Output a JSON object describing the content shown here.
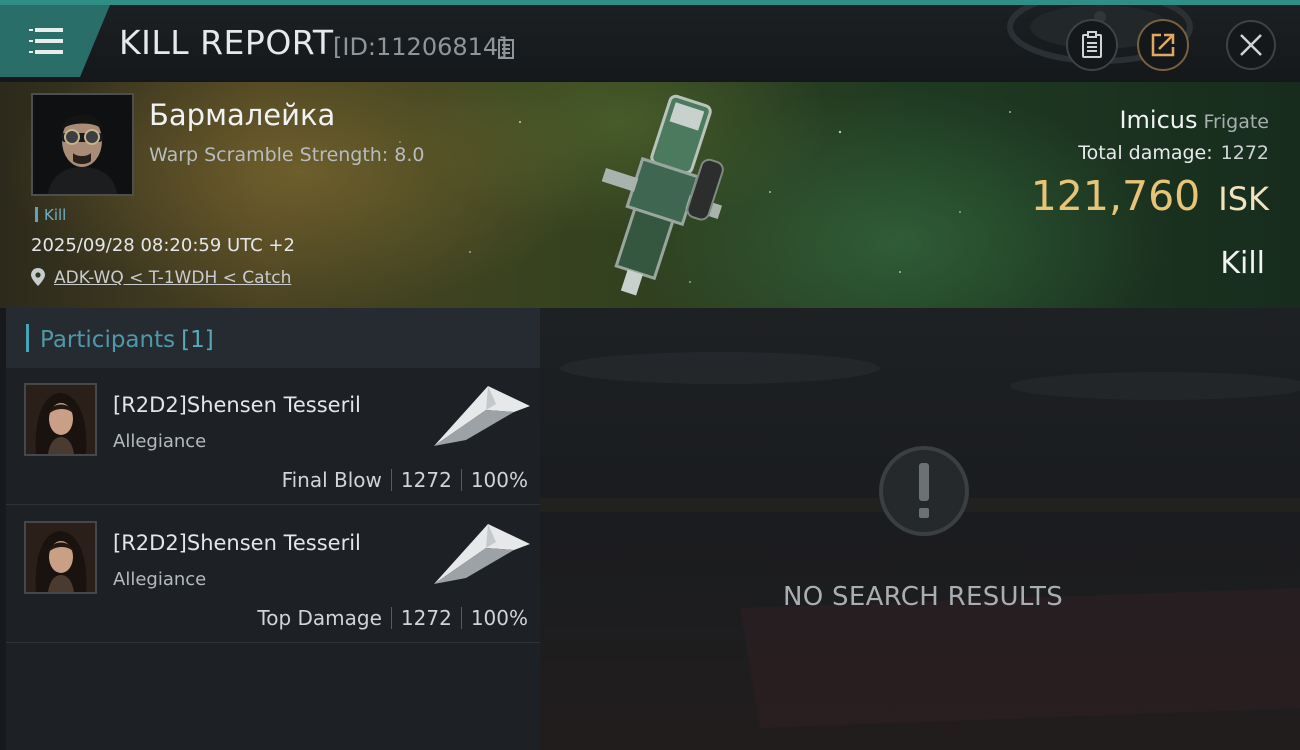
{
  "header": {
    "title": "KILL REPORT",
    "report_id": "[ID:11206814]",
    "icons": {
      "menu": "hamburger-menu-icon",
      "copy": "copy-icon",
      "clipboard": "clipboard-icon",
      "share": "share-icon",
      "close": "close-icon"
    }
  },
  "victim": {
    "name": "Бармалейка",
    "subtitle": "Warp Scramble Strength: 8.0",
    "kill_tag": "Kill",
    "timestamp": "2025/09/28 08:20:59 UTC +2",
    "location": "ADK-WQ < T-1WDH < Catch",
    "ship_name": "Imicus",
    "ship_class": "Frigate",
    "damage_label": "Total damage:",
    "damage_value": "1272",
    "isk_value": "121,760",
    "isk_unit": "ISK",
    "result": "Kill"
  },
  "participants": {
    "label": "Participants",
    "count": "[1]",
    "rows": [
      {
        "name": "[R2D2]Shensen Tesseril",
        "corp": "Allegiance",
        "role": "Final Blow",
        "damage": "1272",
        "percent": "100%"
      },
      {
        "name": "[R2D2]Shensen Tesseril",
        "corp": "Allegiance",
        "role": "Top Damage",
        "damage": "1272",
        "percent": "100%"
      }
    ]
  },
  "empty_state": {
    "text": "NO SEARCH RESULTS",
    "icon": "exclamation-icon"
  },
  "colors": {
    "accent_teal": "#2a6e69",
    "isk_gold": "#e8c477",
    "participant_label": "#4f98aa"
  }
}
